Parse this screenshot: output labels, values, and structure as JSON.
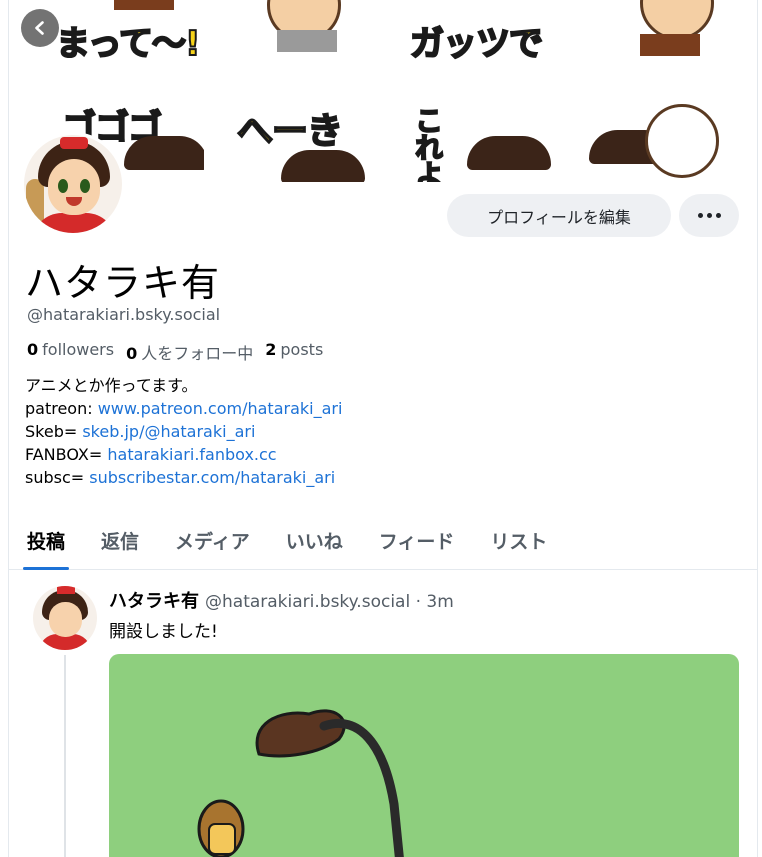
{
  "banner": {
    "tiles_top": [
      "まって〜!",
      "",
      "ガッツで",
      ""
    ],
    "tiles_bottom": [
      "ゴゴゴ",
      "へーき",
      "これよ",
      ""
    ]
  },
  "profile": {
    "display_name": "ハタラキ有",
    "handle": "@hatarakiari.bsky.social",
    "followers_count": "0",
    "followers_label": "followers",
    "following_count": "0",
    "following_label": "人をフォロー中",
    "posts_count": "2",
    "posts_label": "posts",
    "edit_button": "プロフィールを編集",
    "bio": {
      "line1": "アニメとか作ってます。",
      "links": [
        {
          "label": "patreon: ",
          "url": "www.patreon.com/hataraki_ari"
        },
        {
          "label": "Skeb= ",
          "url": "skeb.jp/@hataraki_ari"
        },
        {
          "label": "FANBOX= ",
          "url": "hatarakiari.fanbox.cc"
        },
        {
          "label": "subsc= ",
          "url": "subscribestar.com/hataraki_ari"
        }
      ]
    }
  },
  "tabs": [
    "投稿",
    "返信",
    "メディア",
    "いいね",
    "フィード",
    "リスト"
  ],
  "post": {
    "author": "ハタラキ有",
    "handle_time": "@hatarakiari.bsky.social · 3m",
    "text": "開設しました!"
  },
  "colors": {
    "link": "#1d72d6",
    "tab_indicator": "#1d72d6",
    "image_bg": "#8ecf7e"
  }
}
